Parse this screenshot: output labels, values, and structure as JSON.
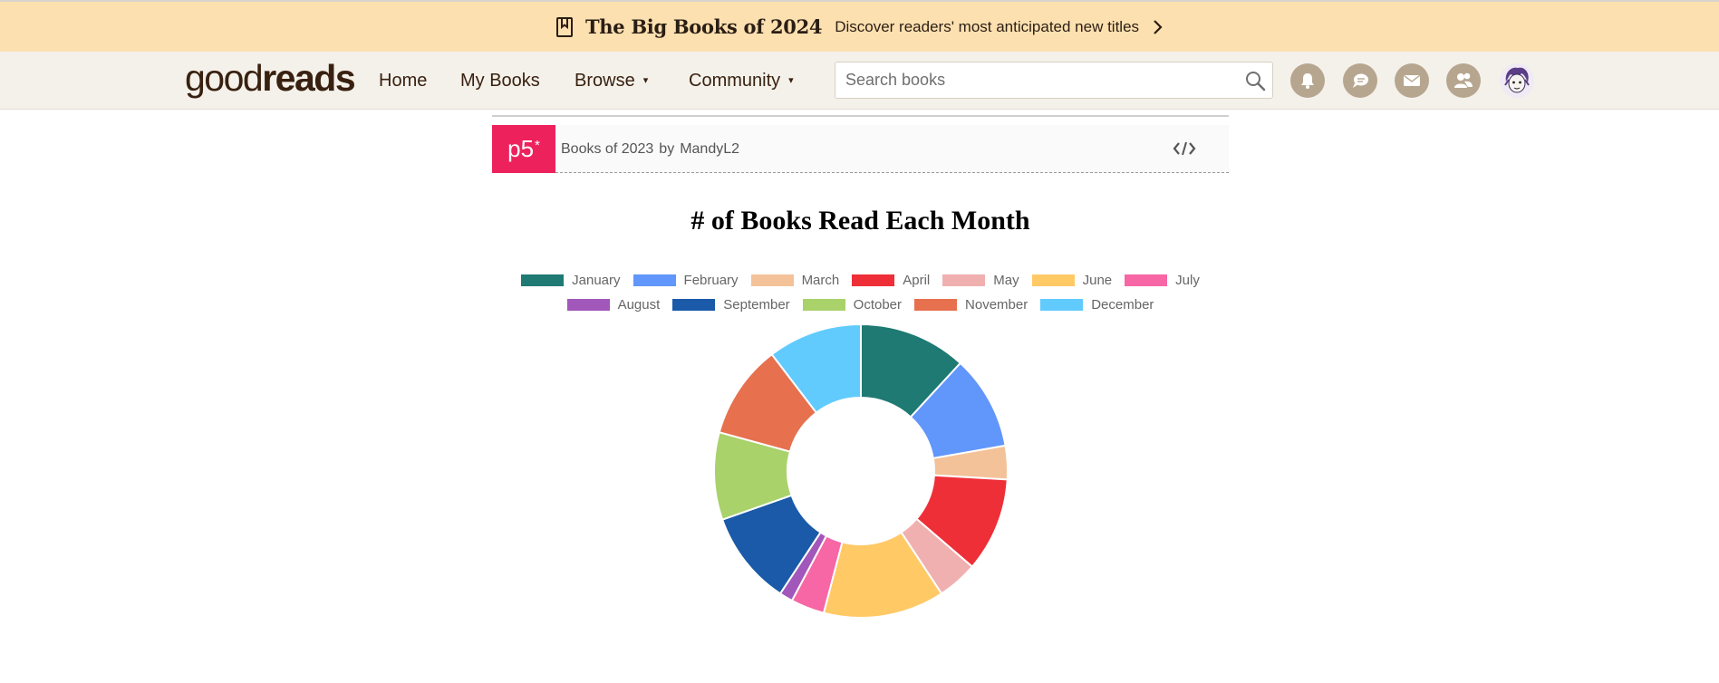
{
  "promo": {
    "title": "The Big Books of 2024",
    "subtitle": "Discover readers' most anticipated new titles"
  },
  "header": {
    "logo": {
      "light": "good",
      "bold": "reads"
    },
    "nav": [
      {
        "label": "Home"
      },
      {
        "label": "My Books"
      },
      {
        "label": "Browse",
        "caret": "▾"
      },
      {
        "label": "Community",
        "caret": "▾"
      }
    ],
    "search_placeholder": "Search books",
    "icons": [
      "notifications-icon",
      "discussions-icon",
      "messages-icon",
      "friends-icon"
    ]
  },
  "sketch": {
    "logo": "p5",
    "logo_mark": "*",
    "title": "Books of 2023",
    "by": "by",
    "author": "MandyL2"
  },
  "chart_data": {
    "type": "pie",
    "title": "# of Books Read Each Month",
    "legend_position": "top",
    "categories": [
      "January",
      "February",
      "March",
      "April",
      "May",
      "June",
      "July",
      "August",
      "September",
      "October",
      "November",
      "December"
    ],
    "values": [
      8,
      7,
      2.5,
      7,
      3,
      9,
      2.5,
      1,
      7,
      6.5,
      7,
      7
    ],
    "colors": [
      "#1e7a73",
      "#6196fa",
      "#f3c299",
      "#ee2f37",
      "#f1b0b0",
      "#ffc966",
      "#f767a5",
      "#a257ba",
      "#1a5aa8",
      "#a9d26b",
      "#e7704f",
      "#61cbfe"
    ],
    "cutout": 0.5
  }
}
